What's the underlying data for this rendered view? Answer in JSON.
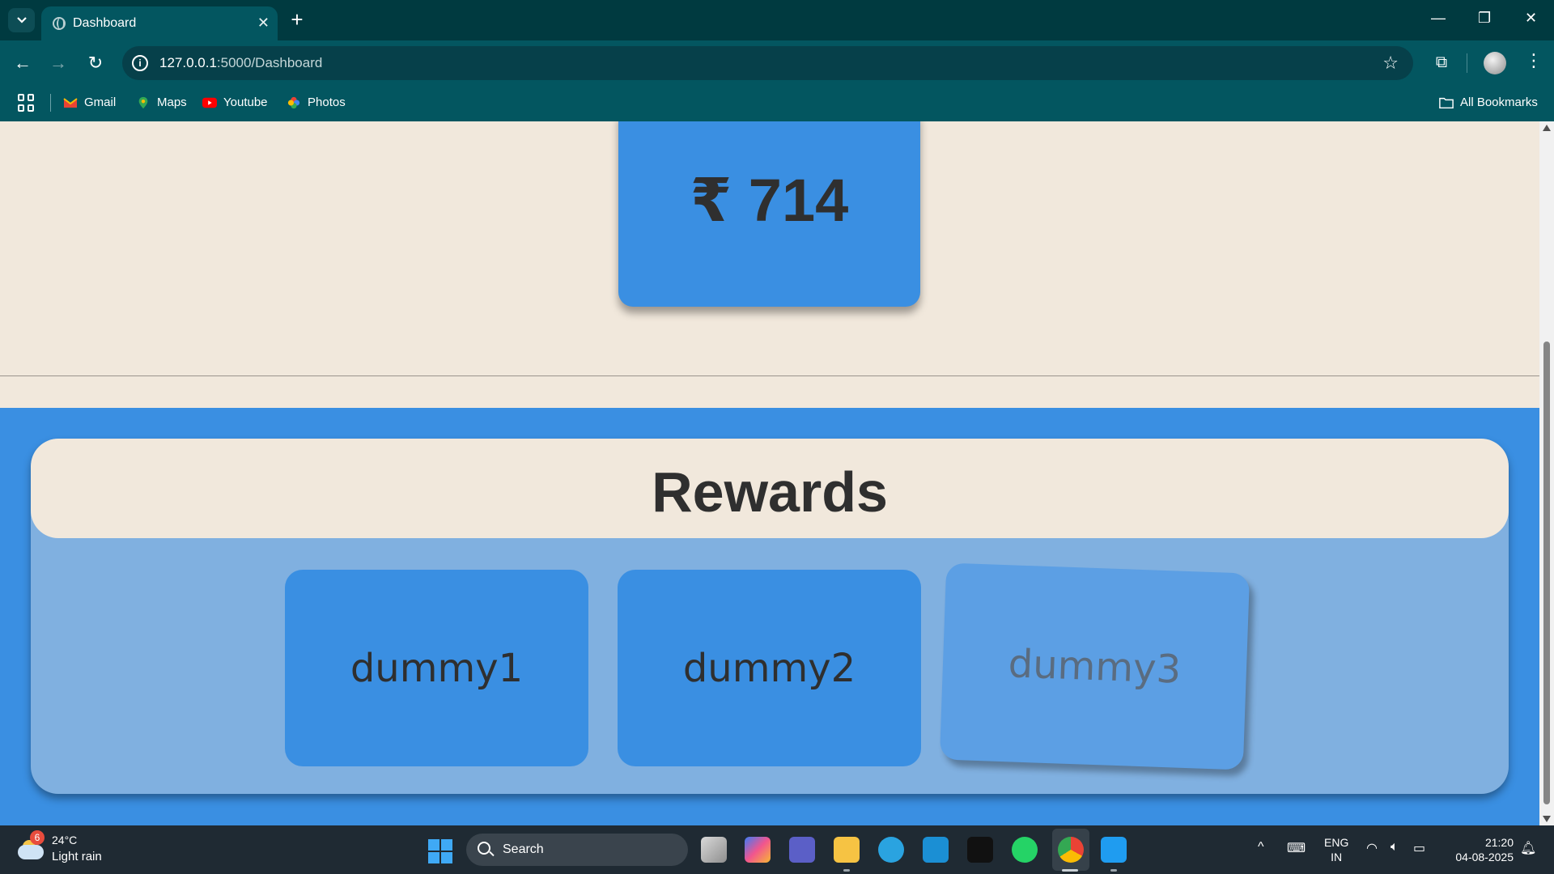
{
  "browser": {
    "tab_title": "Dashboard",
    "url_host": "127.0.0.1",
    "url_path": ":5000/Dashboard",
    "bookmarks": [
      {
        "label": "Gmail",
        "icon": "gmail-icon"
      },
      {
        "label": "Maps",
        "icon": "maps-icon"
      },
      {
        "label": "Youtube",
        "icon": "youtube-icon"
      },
      {
        "label": "Photos",
        "icon": "photos-icon"
      }
    ],
    "all_bookmarks": "All Bookmarks"
  },
  "page": {
    "balance": "₹ 714",
    "rewards_title": "Rewards",
    "rewards": [
      {
        "label": "dummy1",
        "state": "normal"
      },
      {
        "label": "dummy2",
        "state": "normal"
      },
      {
        "label": "dummy3",
        "state": "hovered"
      }
    ]
  },
  "taskbar": {
    "weather_badge": "6",
    "weather_temp": "24°C",
    "weather_desc": "Light rain",
    "search_placeholder": "Search",
    "lang_line1": "ENG",
    "lang_line2": "IN",
    "time": "21:20",
    "date": "04-08-2025"
  },
  "colors": {
    "accent_blue": "#3a8fe2",
    "panel_blue": "#80b0e0",
    "cream": "#f1e8dc",
    "browser_teal": "#035660"
  }
}
